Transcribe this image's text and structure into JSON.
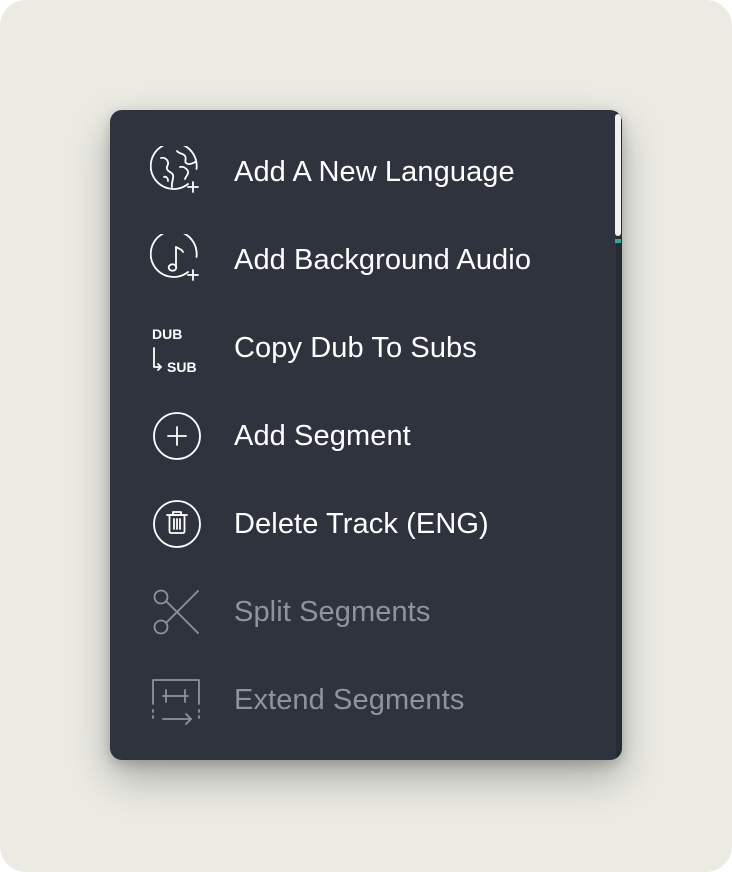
{
  "menu": {
    "items": [
      {
        "label": "Add A New Language",
        "icon": "globe-plus-icon",
        "enabled": true
      },
      {
        "label": "Add Background Audio",
        "icon": "music-note-plus-icon",
        "enabled": true
      },
      {
        "label": "Copy Dub To Subs",
        "icon": "dub-to-sub-icon",
        "enabled": true,
        "icon_text_top": "DUB",
        "icon_text_bottom": "SUB"
      },
      {
        "label": "Add Segment",
        "icon": "plus-circle-icon",
        "enabled": true
      },
      {
        "label": "Delete Track (ENG)",
        "icon": "trash-circle-icon",
        "enabled": true
      },
      {
        "label": "Split Segments",
        "icon": "scissors-icon",
        "enabled": false
      },
      {
        "label": "Extend Segments",
        "icon": "extend-segments-icon",
        "enabled": false
      }
    ]
  },
  "colors": {
    "menu_background": "#2e333d",
    "enabled_text": "#ffffff",
    "disabled_text": "#8e949f",
    "backdrop": "#ebebe4",
    "scroll_accent": "#3aa79a"
  }
}
